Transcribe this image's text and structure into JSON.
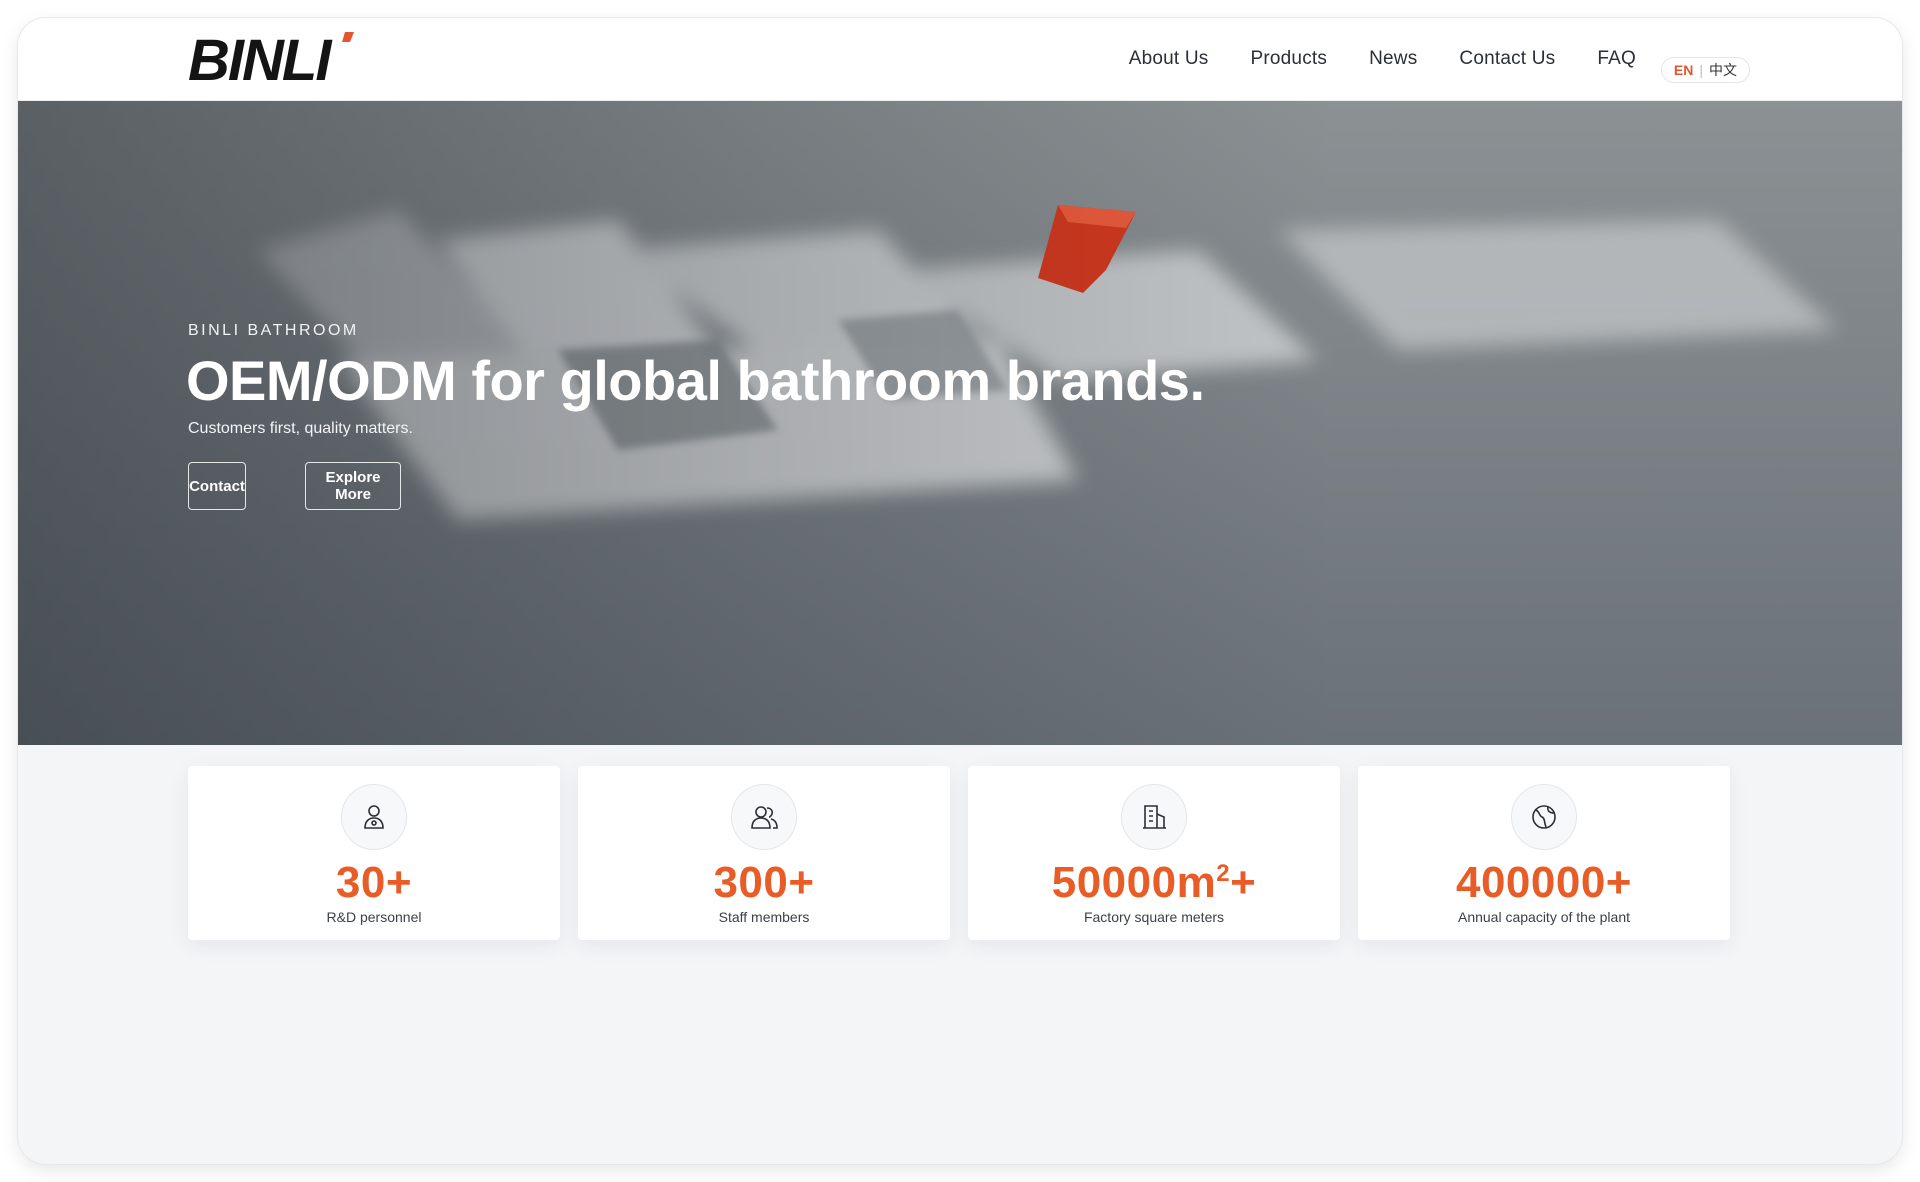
{
  "header": {
    "logo_text": "BINLI",
    "nav": [
      {
        "label": "About Us"
      },
      {
        "label": "Products"
      },
      {
        "label": "News"
      },
      {
        "label": "Contact Us"
      },
      {
        "label": "FAQ"
      }
    ],
    "lang": {
      "en": "EN",
      "separator": "|",
      "zh": "中文"
    }
  },
  "hero": {
    "eyebrow": "BINLI BATHROOM",
    "title": "OEM/ODM for global bathroom brands.",
    "subtitle": "Customers first, quality matters.",
    "buttons": {
      "contact": "Contact",
      "explore": "Explore More"
    }
  },
  "stats": [
    {
      "icon": "engineer-icon",
      "value": "30+",
      "label": "R&D personnel"
    },
    {
      "icon": "staff-group-icon",
      "value": "300+",
      "label": "Staff members"
    },
    {
      "icon": "building-icon",
      "value_main": "50000m",
      "value_sup": "2",
      "value_tail": "+",
      "label": "Factory square meters"
    },
    {
      "icon": "globe-icon",
      "value": "400000+",
      "label": "Annual capacity of the plant"
    }
  ],
  "colors": {
    "accent": "#e85d27",
    "nav_text": "#2b2f36",
    "page_bg": "#f4f5f7"
  }
}
